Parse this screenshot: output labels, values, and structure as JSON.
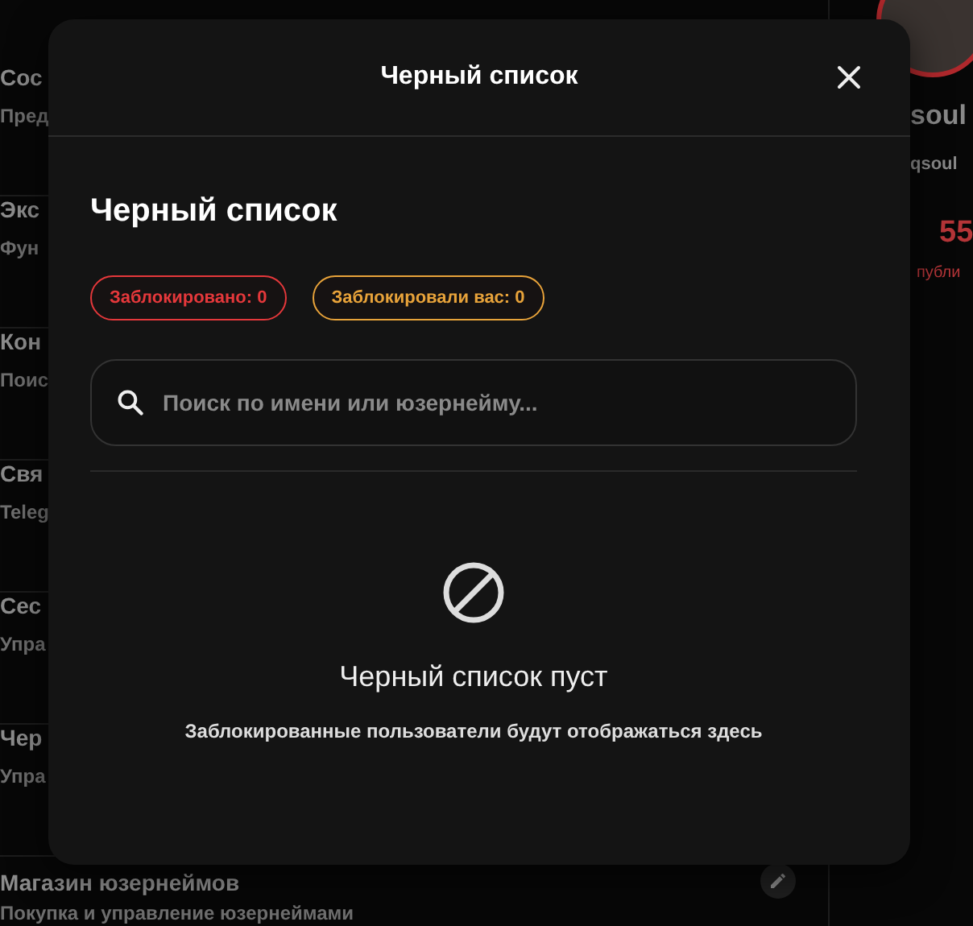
{
  "background": {
    "settings_items": [
      {
        "title": "Сос",
        "subtitle": "Пред"
      },
      {
        "title": "Экс",
        "subtitle": "Фун"
      },
      {
        "title": "Кон",
        "subtitle": "Поис"
      },
      {
        "title": "Свя",
        "subtitle": "Teleg"
      },
      {
        "title": "Сес",
        "subtitle": "Упра"
      },
      {
        "title": "Чер",
        "subtitle": "Упра"
      },
      {
        "title": "Магазин юзернеймов",
        "subtitle": "Покупка и управление юзернеймами"
      }
    ],
    "profile": {
      "name": "soul",
      "username": "qsoul",
      "stat_value": "55",
      "stat_label": "публи"
    }
  },
  "modal": {
    "title": "Черный список",
    "heading": "Черный список",
    "badges": [
      {
        "label": "Заблокировано: 0",
        "color": "#e5383b"
      },
      {
        "label": "Заблокировали вас: 0",
        "color": "#e8a33a"
      }
    ],
    "search": {
      "placeholder": "Поиск по имени или юзернейму..."
    },
    "empty_state": {
      "title": "Черный список пуст",
      "message": "Заблокированные пользователи будут отображаться здесь"
    }
  }
}
